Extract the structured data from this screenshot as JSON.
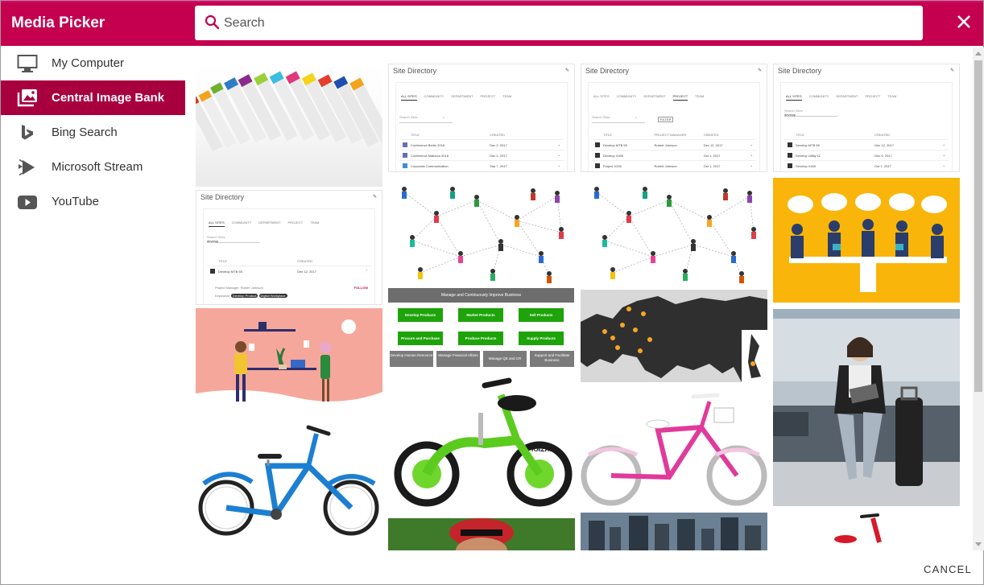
{
  "app": {
    "title": "Media Picker"
  },
  "search": {
    "placeholder": "Search",
    "value": ""
  },
  "sidebar": {
    "items": [
      {
        "label": "My Computer",
        "icon": "monitor-icon"
      },
      {
        "label": "Central Image Bank",
        "icon": "image-gallery-icon",
        "active": true
      },
      {
        "label": "Bing Search",
        "icon": "bing-icon"
      },
      {
        "label": "Microsoft Stream",
        "icon": "stream-icon"
      },
      {
        "label": "YouTube",
        "icon": "youtube-icon"
      }
    ]
  },
  "footer": {
    "cancel_label": "CANCEL"
  },
  "colors": {
    "brand": "#c4004f",
    "active": "#a8003f"
  },
  "gallery": {
    "site_directory": {
      "title": "Site Directory",
      "tabs": [
        "ALL SITES",
        "COMMUNITY",
        "DEPARTMENT",
        "PROJECT",
        "TEAM"
      ],
      "search_placeholder": "Search Sites",
      "search_value": "develop",
      "filter_label": "FILTER",
      "col_title": "TITLE",
      "col_manager": "PROJECT MANAGER",
      "col_created": "CREATED",
      "a_rows": [
        {
          "title": "Conference Berlin 2018",
          "created": "Dec 2, 2017"
        },
        {
          "title": "Conference Mallorca 2018",
          "created": "Dec 2, 2017"
        },
        {
          "title": "Corporate Communication",
          "created": "Sep 7, 2017"
        }
      ],
      "b_rows": [
        {
          "title": "Develop MTB 55",
          "manager": "Robert Johnson",
          "created": "Dec 12, 2017"
        },
        {
          "title": "Develop X400",
          "manager": "",
          "created": "Oct 1, 2017"
        },
        {
          "title": "Project X200",
          "manager": "Robert Johnson",
          "created": "Oct 1, 2017"
        }
      ],
      "c_rows": [
        {
          "title": "Develop MTB 55",
          "created": "Dec 12, 2017"
        },
        {
          "title": "Develop Utility 11",
          "created": "Dec 5, 2017"
        },
        {
          "title": "Develop X400",
          "created": "Oct 1, 2017"
        }
      ],
      "d_row": {
        "title": "Develop MTB 55",
        "created": "Dec 12, 2017"
      },
      "d_detail": "Project Manager: Robert Johnson",
      "d_keywords_label": "Keywords:",
      "d_keywords": [
        "Develop Product",
        "Digital Workplace"
      ],
      "d_follow": "FOLLOW"
    },
    "process": {
      "banner": "Manage and Continuously Improve Business",
      "green": [
        "Develop Products",
        "Market Products",
        "Sell Products",
        "Procure and Purchase",
        "Produce Products",
        "Supply Products"
      ],
      "gray": [
        "Develop Human Resource",
        "Manage Financial Affairs",
        "Manage QE and CR",
        "Support and Facilitate Business"
      ]
    }
  }
}
